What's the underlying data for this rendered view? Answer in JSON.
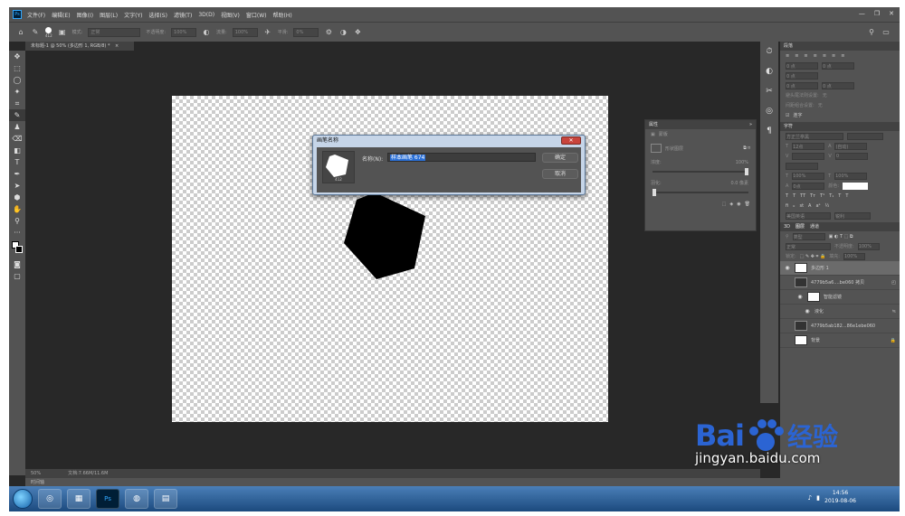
{
  "app": {
    "menu": [
      "文件(F)",
      "编辑(E)",
      "图像(I)",
      "图层(L)",
      "文字(Y)",
      "选择(S)",
      "滤镜(T)",
      "3D(D)",
      "视图(V)",
      "窗口(W)",
      "帮助(H)"
    ],
    "logo": "Ps"
  },
  "options": {
    "brush_size": "412",
    "mode_label": "模式:",
    "mode_value": "正常",
    "opacity_label": "不透明度:",
    "opacity_value": "100%",
    "flow_label": "流量:",
    "flow_value": "100%",
    "smooth_label": "平滑:",
    "smooth_value": "0%"
  },
  "document": {
    "tab_title": "未标题-1 @ 50% (多边形 1, RGB/8) *",
    "zoom": "50%",
    "doc_info": "文档:7.66M/11.6M"
  },
  "timeline_label": "时间轴",
  "properties_panel": {
    "title": "属性",
    "type_label": "蒙版",
    "subtitle": "形状图层",
    "density_label": "浓度:",
    "density_value": "100%",
    "feather_label": "羽化:",
    "feather_value": "0.0 像素"
  },
  "paragraph_panel": {
    "title": "段落",
    "fields": [
      "0 点",
      "0 点",
      "0 点",
      "0 点",
      "0 点"
    ],
    "hyphen_label": "避头尾法则设置:",
    "hyphen_value": "无",
    "spacing_label": "间距组合设置:",
    "spacing_value": "无",
    "hyphenate_label": "连字"
  },
  "character_panel": {
    "title": "字符",
    "font": "方正兰亭黑",
    "size": "12点",
    "leading": "(自动)",
    "tracking": "0",
    "scale_v": "100%",
    "scale_h": "100%",
    "baseline": "0点",
    "color_label": "颜色:",
    "aa_value": "美国英语",
    "aa_mode": "锐利"
  },
  "layers_panel": {
    "tabs": [
      "3D",
      "图层",
      "通道"
    ],
    "search_placeholder": "类型",
    "blend_mode": "正常",
    "opacity_label": "不透明度:",
    "opacity_value": "100%",
    "lock_label": "锁定:",
    "fill_label": "填充:",
    "fill_value": "100%",
    "layers": [
      {
        "name": "多边形 1",
        "active": true,
        "thumb": "shape"
      },
      {
        "name": "4779b5a6....be060 拷贝",
        "active": false,
        "thumb": "photo"
      },
      {
        "name": "智能滤镜",
        "active": false,
        "thumb": "white"
      },
      {
        "name": "液化",
        "active": false,
        "thumb": "none"
      },
      {
        "name": "4779b5ab182...86e1ebe060",
        "active": false,
        "thumb": "photo"
      },
      {
        "name": "背景",
        "active": false,
        "thumb": "white"
      }
    ]
  },
  "dialog": {
    "title": "画笔名称",
    "name_label": "名称(N):",
    "name_value": "样本画笔 674",
    "brush_size": "412",
    "ok_label": "确定",
    "cancel_label": "取消"
  },
  "taskbar": {
    "time": "14:56",
    "date": "2019-08-06"
  },
  "watermark": {
    "logo_left": "Bai",
    "logo_right": "经验",
    "url": "jingyan.baidu.com"
  }
}
